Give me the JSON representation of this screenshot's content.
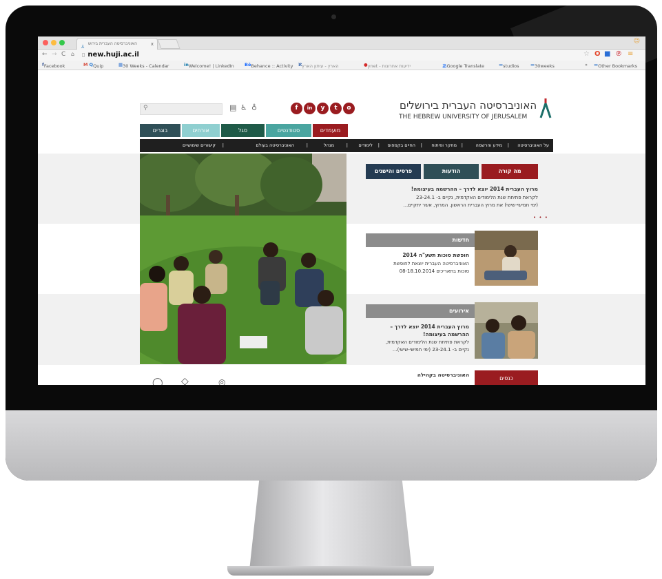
{
  "browser": {
    "tab_title": "האוניברסיטה העברית בירוש",
    "tab_close": "x",
    "url": "new.huji.ac.il",
    "bookmarks": [
      "Facebook",
      "Quip",
      "30 Weeks - Calendar",
      "Welcome! | LinkedIn",
      "Behance :: Activity",
      "הארץ - עיתון הארץ",
      "ynet - ידיעות אחרונות",
      "Google Translate",
      "studios",
      "30weeks",
      "Other Bookmarks"
    ],
    "bookmarks_overflow": "»"
  },
  "site": {
    "logo_hebrew": "האוניברסיטה העברית בירושלים",
    "logo_english": "THE HEBREW UNIVERSITY OF JERUSALEM",
    "search_placeholder": "",
    "social": [
      "f",
      "in",
      "y",
      "t",
      "o"
    ],
    "audiences": [
      "מועמדים",
      "סטודנטים",
      "סגל",
      "אורחים",
      "בוגרים"
    ],
    "main_nav": [
      "על האוניברסיטה",
      "מידע והרשמה",
      "מחקר ופיתוח",
      "החיים בקמפוס",
      "לימודים",
      "מנהל",
      "האוניברסיטה בעולם",
      "קישורים שימושיים"
    ],
    "feature_tabs": [
      "מה קורה",
      "הודעות",
      "פרסים והישגים"
    ],
    "feature": {
      "title": "מרוץ העברית 2014 יוצא לדרך – ההרשמה בעיצומה!",
      "line1": "לקראת פתיחת שנת הלימודים האקדמית, נקיים ב- 23-24.1",
      "line2": "(ימי חמישי-שישי) את מרוץ העברית הראשון. המרוץ, אשר יתקיים...",
      "dots": "• • •"
    },
    "news": {
      "header": "חדשות",
      "title": "חופשת סוכות תשע\"ה 2014",
      "line1": "האוניברסיטה העברית יוצאת לחופשת",
      "line2": "סוכות בתאריכים 08-18.10.2014"
    },
    "events": {
      "header": "אירועים",
      "title1": "מרוץ העברית 2014 יוצא לדרך –",
      "title2": "ההרשמה בעיצומה!",
      "line1": "לקראת פתיחת שנת הלימודים האקדמית,",
      "line2": "נקיים ב- 23-24.1 (ימי חמישי-שישי)..."
    },
    "bottom": {
      "button": "כנסים",
      "heading": "האוניברסיטה בקהילה"
    }
  },
  "colors": {
    "brand_red": "#9a1c20",
    "teal": "#4aa5a0",
    "light_teal": "#8fcfd0",
    "dark_green": "#1f5a48",
    "dark_slate": "#2f4f57",
    "navy": "#243b52",
    "nav_black": "#1f1f1f",
    "gray_header": "#8c8c8c"
  }
}
